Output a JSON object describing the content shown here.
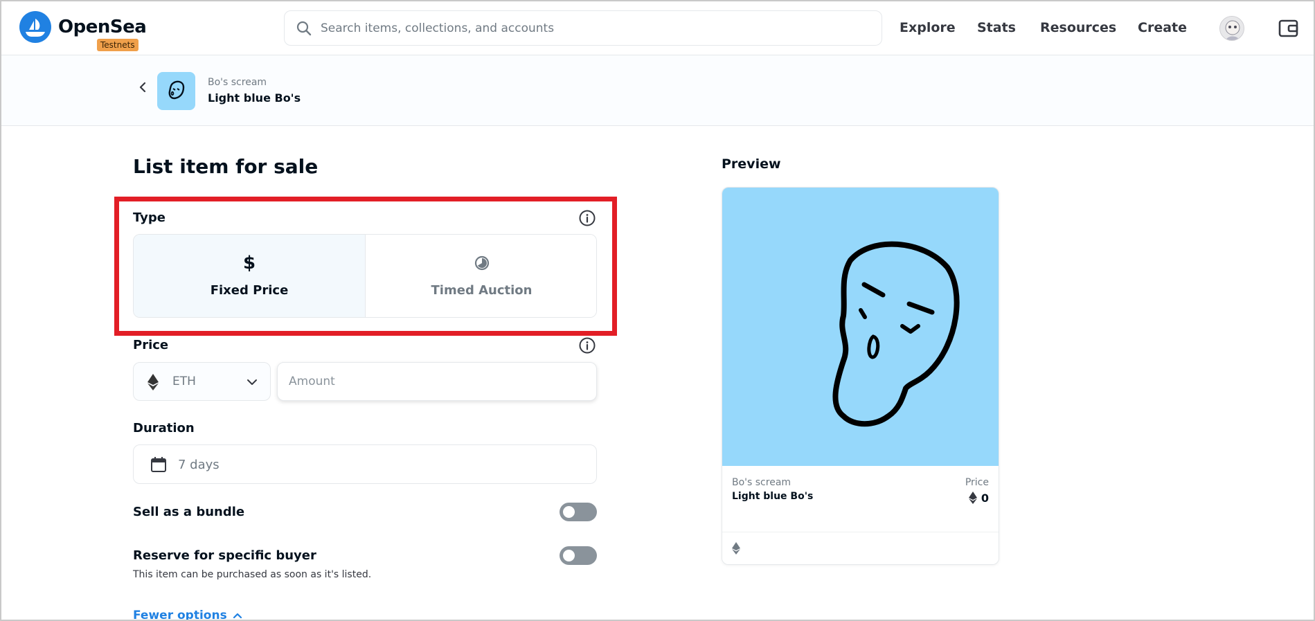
{
  "header": {
    "logo_text": "OpenSea",
    "testnets_badge": "Testnets",
    "search_placeholder": "Search items, collections, and accounts",
    "nav": [
      "Explore",
      "Stats",
      "Resources",
      "Create"
    ]
  },
  "item": {
    "collection": "Bo's scream",
    "name": "Light blue Bo's"
  },
  "form": {
    "title": "List item for sale",
    "type_label": "Type",
    "type_options": [
      {
        "label": "Fixed Price",
        "glyph": "$",
        "selected": true
      },
      {
        "label": "Timed Auction",
        "glyph": "",
        "selected": false
      }
    ],
    "price_label": "Price",
    "currency": "ETH",
    "amount_placeholder": "Amount",
    "duration_label": "Duration",
    "duration_value": "7 days",
    "bundle_label": "Sell as a bundle",
    "bundle_on": false,
    "reserve_label": "Reserve for specific buyer",
    "reserve_on": false,
    "reserve_helper": "This item can be purchased as soon as it's listed.",
    "fewer_options": "Fewer options"
  },
  "preview": {
    "title": "Preview",
    "collection": "Bo's scream",
    "name": "Light blue Bo's",
    "price_label": "Price",
    "price_value": "0"
  },
  "colors": {
    "accent": "#2081e2",
    "highlight": "#e21e26",
    "artwork_bg": "#96d8fb",
    "testnets_badge": "#f0a04b"
  },
  "icons": [
    "search-icon",
    "avatar",
    "wallet-icon",
    "chevron-left-icon",
    "info-icon",
    "dollar-icon",
    "clock-icon",
    "eth-icon",
    "chevron-down-icon",
    "calendar-icon",
    "chevron-up-icon"
  ]
}
